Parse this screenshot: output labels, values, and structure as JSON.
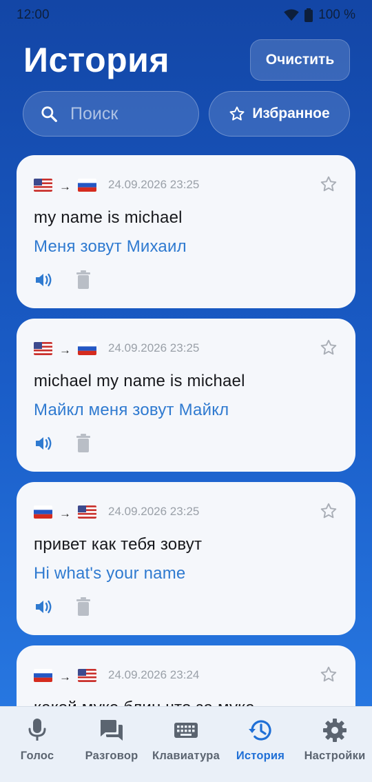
{
  "status_bar": {
    "time": "12:00",
    "battery": "100 %"
  },
  "header": {
    "title": "История",
    "clear_label": "Очистить"
  },
  "search": {
    "placeholder": "Поиск"
  },
  "favorites": {
    "label": "Избранное"
  },
  "cards": [
    {
      "from": "us",
      "to": "ru",
      "arrow": "→",
      "date": "24.09.2026 23:25",
      "original": "my name is michael",
      "translation": "Меня зовут Михаил"
    },
    {
      "from": "us",
      "to": "ru",
      "arrow": "→",
      "date": "24.09.2026 23:25",
      "original": "michael my name is michael",
      "translation": "Майкл меня зовут Майкл"
    },
    {
      "from": "ru",
      "to": "us",
      "arrow": "→",
      "date": "24.09.2026 23:25",
      "original": "привет как тебя зовут",
      "translation": "Hi what's your name"
    },
    {
      "from": "ru",
      "to": "us",
      "arrow": "→",
      "date": "24.09.2026 23:24",
      "original": "какой муке блин что за мука",
      "translation": ""
    }
  ],
  "nav": [
    {
      "label": "Голос",
      "icon": "mic-icon",
      "active": false
    },
    {
      "label": "Разговор",
      "icon": "chat-icon",
      "active": false
    },
    {
      "label": "Клавиатура",
      "icon": "keyboard-icon",
      "active": false
    },
    {
      "label": "История",
      "icon": "history-icon",
      "active": true
    },
    {
      "label": "Настройки",
      "icon": "gear-icon",
      "active": false
    }
  ],
  "colors": {
    "accent": "#1f6fd6",
    "translation": "#2f7ad0",
    "inactive": "#5b6470"
  }
}
